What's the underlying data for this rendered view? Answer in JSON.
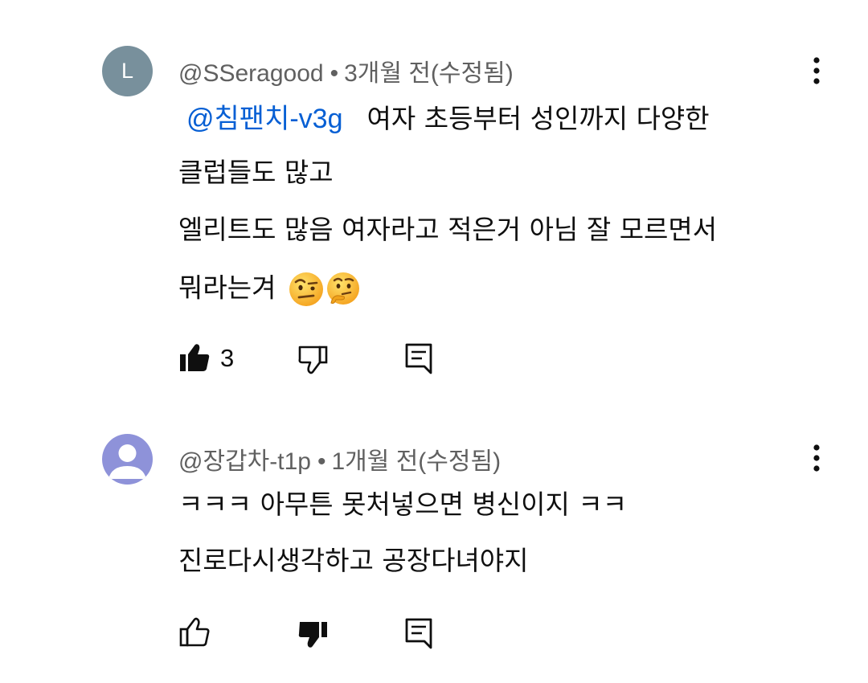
{
  "comments": [
    {
      "avatar_letter": "L",
      "avatar_color": "#78909c",
      "author": "@SSeragood",
      "separator": "•",
      "time": "3개월 전(수정됨)",
      "mention": "@침팬치-v3g",
      "lines": [
        "여자 초등부터 성인까지 다양한",
        "클럽들도 많고",
        "엘리트도 많음 여자라고 적은거 아님 잘 모르면서",
        "뭐라는겨"
      ],
      "emojis": [
        "face-with-raised-eyebrow-emoji",
        "thinking-face-emoji"
      ],
      "like_count": "3",
      "liked": true,
      "disliked": false
    },
    {
      "avatar_color": "#8e92d9",
      "author": "@장갑차-t1p",
      "separator": "•",
      "time": "1개월 전(수정됨)",
      "lines": [
        "ㅋㅋㅋ 아무튼 못처넣으면 병신이지 ㅋㅋ",
        "진로다시생각하고 공장다녀야지"
      ],
      "like_count": "",
      "liked": false,
      "disliked": true
    }
  ],
  "colors": {
    "mention": "#065fd4",
    "meta": "#606060",
    "text": "#0f0f0f"
  }
}
